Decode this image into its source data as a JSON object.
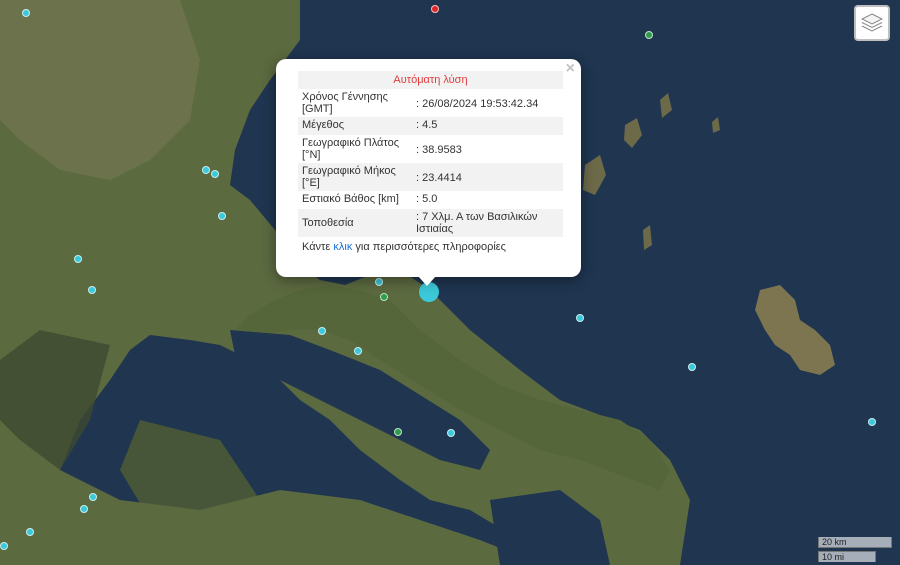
{
  "map": {
    "layer_icon": "layers-icon",
    "colors": {
      "sea": "#1f3550",
      "land": "#5c6a40",
      "recent_quake": "#3cc8d8",
      "older_quake": "#2e9d4a",
      "latest_quake": "#e0262a"
    }
  },
  "popup": {
    "title": "Αυτόματη λύση",
    "close": "×",
    "rows": [
      {
        "label": "Χρόνος Γέννησης [GMT]",
        "value": ": 26/08/2024 19:53:42.34"
      },
      {
        "label": "Μέγεθος",
        "value": ": 4.5"
      },
      {
        "label": "Γεωγραφικό Πλάτος [°N]",
        "value": ": 38.9583"
      },
      {
        "label": "Γεωγραφικό Μήκος [°E]",
        "value": ": 23.4414"
      },
      {
        "label": "Εστιακό Βάθος [km]",
        "value": ": 5.0"
      },
      {
        "label": "Τοποθεσία",
        "value": ": 7 Χλμ. Α των Βασιλικών Ιστιαίας"
      }
    ],
    "more_prefix": "Κάντε ",
    "more_link": "κλικ",
    "more_suffix": " για περισσότερες πληροφορίες"
  },
  "scale": {
    "km": "20 km",
    "mi": "10 mi"
  }
}
